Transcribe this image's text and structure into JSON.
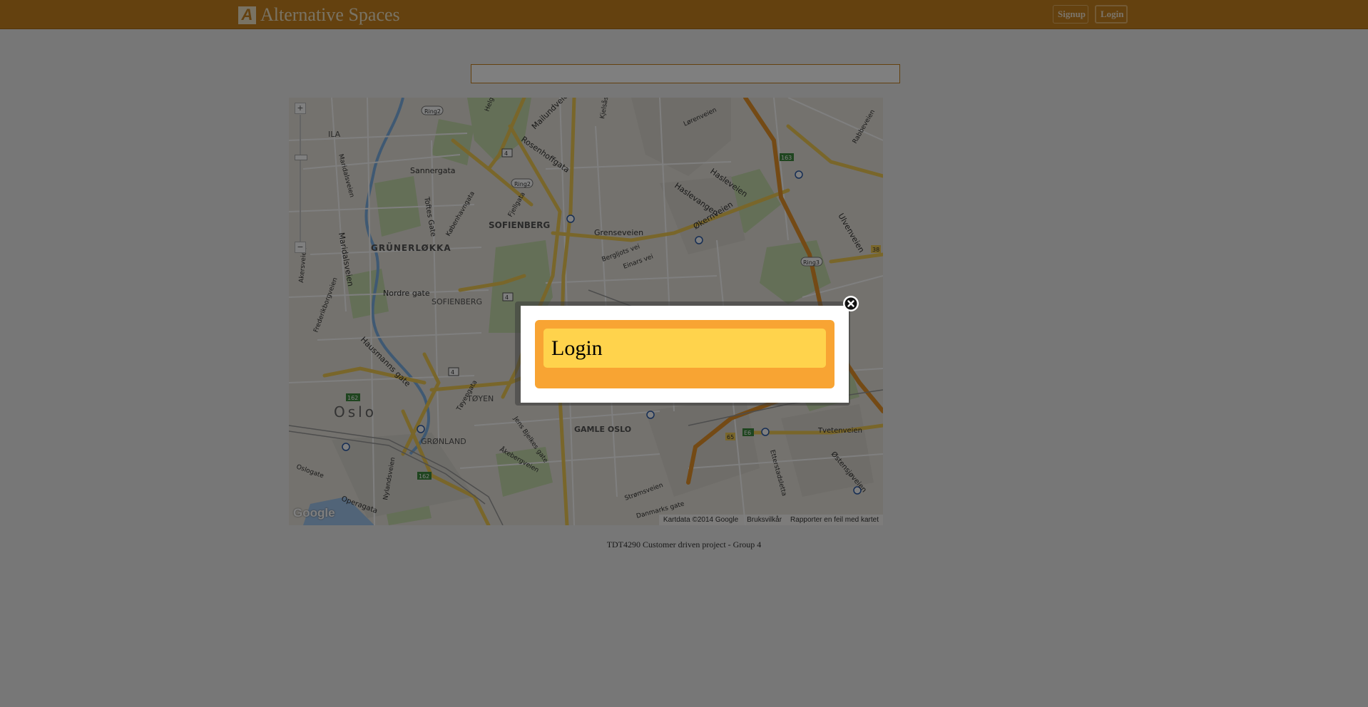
{
  "header": {
    "brand_name": "Alternative Spaces",
    "logo_letter": "A",
    "signup_label": "Signup",
    "login_label": "Login"
  },
  "search": {
    "value": "",
    "placeholder": ""
  },
  "map": {
    "zoom_in_label": "+",
    "zoom_out_label": "−",
    "labels": [
      "Ring2",
      "Ring2",
      "Ring3",
      "Sannergata",
      "Rosenhoffgata",
      "Maridalsveien",
      "GRÜNERLØKKA",
      "SOFIENBERG",
      "SOFIENBERG",
      "Grenseveien",
      "Økernveien",
      "Hasleveien",
      "Haslevangen",
      "Ulvenveien",
      "Nordre gate",
      "Fjellgata",
      "Toftes Gate",
      "Københavngata",
      "Helgesensgate",
      "Hausmanns gate",
      "TØYEN",
      "GRØNLAND",
      "GAMLE OSLO",
      "Oslo",
      "Åkebergveien",
      "Tøyengata",
      "Jens Bjelkes gate",
      "Tvetenveien",
      "Østensjøveien",
      "Strømsveien",
      "Danmarks gate",
      "Operagata",
      "Nylandsveien",
      "Lørenveien",
      "Rabbeveien",
      "Etterstadsletta",
      "Akersveien",
      "Frederikborgveien",
      "Oslogate",
      "ILA",
      "Maridalsveien",
      "Bergljots vei",
      "Einars vei",
      "4",
      "4",
      "4",
      "163",
      "162",
      "162",
      "E6",
      "65",
      "38",
      "Mailundveien",
      "Kjelsåsveien"
    ],
    "google_logo": "Google",
    "attribution": {
      "data": "Kartdata ©2014 Google",
      "terms": "Bruksvilkår",
      "report": "Rapporter en feil med kartet"
    }
  },
  "footer": {
    "text": "TDT4290 Customer driven project - Group 4"
  },
  "modal": {
    "title": "Login"
  },
  "colors": {
    "header_bg": "#c9821f",
    "modal_outer": "#f8a433",
    "modal_header": "#ffd34c",
    "overlay": "rgba(0,0,0,0.5)"
  }
}
